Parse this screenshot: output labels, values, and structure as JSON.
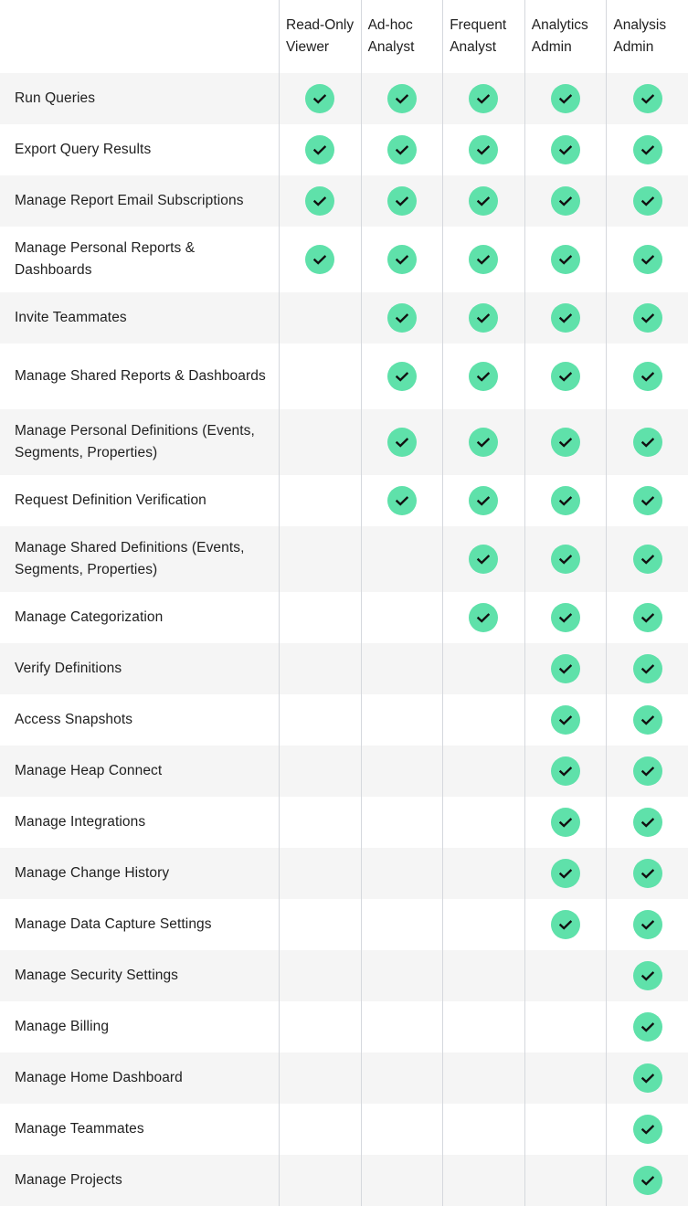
{
  "roles": [
    {
      "line1": "Read-Only",
      "line2": "Viewer"
    },
    {
      "line1": "Ad-hoc",
      "line2": "Analyst"
    },
    {
      "line1": "Frequent",
      "line2": "Analyst"
    },
    {
      "line1": "Analytics",
      "line2": "Admin"
    },
    {
      "line1": "Analysis",
      "line2": "Admin"
    }
  ],
  "check_color": "#5fe1aa",
  "icon": "checkmark-circle-icon",
  "permissions": [
    {
      "label": "Run Queries",
      "lines": 1,
      "allowed": [
        true,
        true,
        true,
        true,
        true
      ]
    },
    {
      "label": "Export Query Results",
      "lines": 1,
      "allowed": [
        true,
        true,
        true,
        true,
        true
      ]
    },
    {
      "label": "Manage Report Email Subscriptions",
      "lines": 1,
      "allowed": [
        true,
        true,
        true,
        true,
        true
      ]
    },
    {
      "label": "Manage Personal Reports & Dashboards",
      "lines": 2,
      "allowed": [
        true,
        true,
        true,
        true,
        true
      ]
    },
    {
      "label": "Invite Teammates",
      "lines": 1,
      "allowed": [
        false,
        true,
        true,
        true,
        true
      ]
    },
    {
      "label": "Manage Shared Reports & Dashboards",
      "lines": 2,
      "allowed": [
        false,
        true,
        true,
        true,
        true
      ]
    },
    {
      "label": "Manage Personal Definitions (Events, Segments, Properties)",
      "lines": 2,
      "allowed": [
        false,
        true,
        true,
        true,
        true
      ]
    },
    {
      "label": "Request Definition Verification",
      "lines": 1,
      "allowed": [
        false,
        true,
        true,
        true,
        true
      ]
    },
    {
      "label": "Manage Shared Definitions (Events, Segments, Properties)",
      "lines": 2,
      "allowed": [
        false,
        false,
        true,
        true,
        true
      ]
    },
    {
      "label": "Manage Categorization",
      "lines": 1,
      "allowed": [
        false,
        false,
        true,
        true,
        true
      ]
    },
    {
      "label": "Verify Definitions",
      "lines": 1,
      "allowed": [
        false,
        false,
        false,
        true,
        true
      ]
    },
    {
      "label": "Access Snapshots",
      "lines": 1,
      "allowed": [
        false,
        false,
        false,
        true,
        true
      ]
    },
    {
      "label": "Manage Heap Connect",
      "lines": 1,
      "allowed": [
        false,
        false,
        false,
        true,
        true
      ]
    },
    {
      "label": "Manage Integrations",
      "lines": 1,
      "allowed": [
        false,
        false,
        false,
        true,
        true
      ]
    },
    {
      "label": "Manage Change History",
      "lines": 1,
      "allowed": [
        false,
        false,
        false,
        true,
        true
      ]
    },
    {
      "label": "Manage Data Capture Settings",
      "lines": 1,
      "allowed": [
        false,
        false,
        false,
        true,
        true
      ]
    },
    {
      "label": "Manage Security Settings",
      "lines": 1,
      "allowed": [
        false,
        false,
        false,
        false,
        true
      ]
    },
    {
      "label": "Manage Billing",
      "lines": 1,
      "allowed": [
        false,
        false,
        false,
        false,
        true
      ]
    },
    {
      "label": "Manage Home Dashboard",
      "lines": 1,
      "allowed": [
        false,
        false,
        false,
        false,
        true
      ]
    },
    {
      "label": "Manage Teammates",
      "lines": 1,
      "allowed": [
        false,
        false,
        false,
        false,
        true
      ]
    },
    {
      "label": "Manage Projects",
      "lines": 1,
      "allowed": [
        false,
        false,
        false,
        false,
        true
      ]
    }
  ]
}
